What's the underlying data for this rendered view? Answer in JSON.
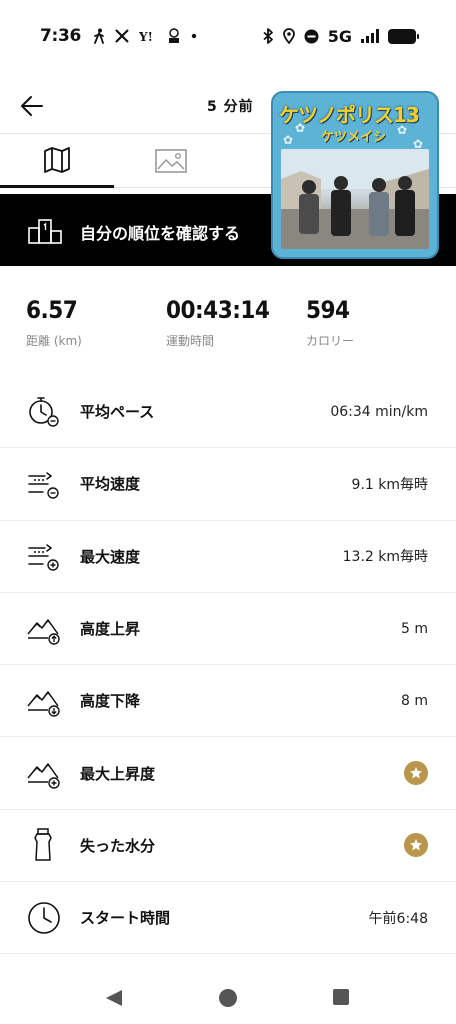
{
  "status_bar": {
    "time": "7:36",
    "network": "5G",
    "left_icons": [
      "walking-icon",
      "x-logo-icon",
      "yahoo-icon",
      "app-icon",
      "dot-icon"
    ],
    "right_icons": [
      "bluetooth-icon",
      "location-icon",
      "dnd-icon",
      "signal-icon",
      "battery-icon"
    ]
  },
  "header": {
    "time_ago": "5 分前"
  },
  "tabs": [
    {
      "name": "map",
      "icon": "map-icon",
      "active": true
    },
    {
      "name": "photo",
      "icon": "image-icon",
      "active": false
    }
  ],
  "album": {
    "title": "ケツノポリス13",
    "artist": "ケツメイシ"
  },
  "banner": {
    "label": "自分の順位を確認する"
  },
  "summary": {
    "distance": {
      "value": "6.57",
      "label": "距離 (km)"
    },
    "duration": {
      "value": "00:43:14",
      "label": "運動時間"
    },
    "calories": {
      "value": "594",
      "label": "カロリー"
    }
  },
  "metrics": [
    {
      "label": "平均ペース",
      "value": "06:34 min/km",
      "icon": "stopwatch-icon"
    },
    {
      "label": "平均速度",
      "value": "9.1 km毎時",
      "icon": "speed-avg-icon"
    },
    {
      "label": "最大速度",
      "value": "13.2 km毎時",
      "icon": "speed-max-icon"
    },
    {
      "label": "高度上昇",
      "value": "5 m",
      "icon": "elevation-gain-icon"
    },
    {
      "label": "高度下降",
      "value": "8 m",
      "icon": "elevation-loss-icon"
    },
    {
      "label": "最大上昇度",
      "value": "",
      "icon": "elevation-max-icon",
      "premium": true
    },
    {
      "label": "失った水分",
      "value": "",
      "icon": "water-bottle-icon",
      "premium": true
    },
    {
      "label": "スタート時間",
      "value": "午前6:48",
      "icon": "clock-icon"
    }
  ],
  "colors": {
    "banner_bg": "#000000",
    "premium_star": "#b8964b",
    "album_bg": "#5cb3d6",
    "album_title": "#f3d12b"
  }
}
